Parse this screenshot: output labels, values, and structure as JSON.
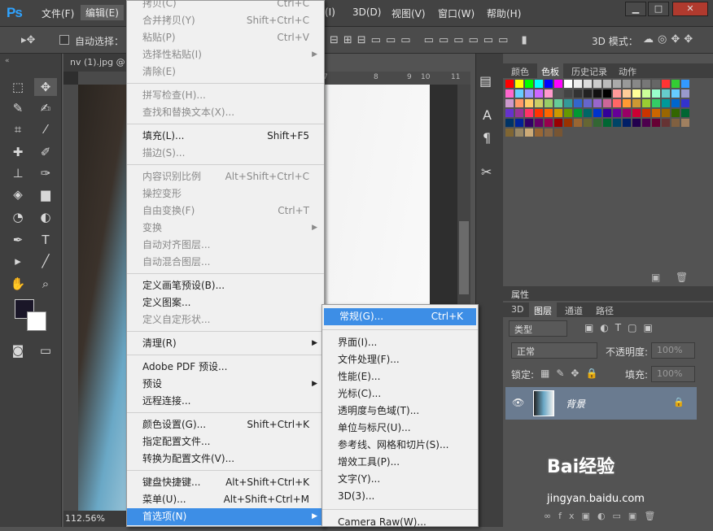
{
  "app": {
    "logo": "Ps"
  },
  "menubar": {
    "items": [
      "文件(F)",
      "编辑(E)",
      "(I)",
      "3D(D)",
      "视图(V)",
      "窗口(W)",
      "帮助(H)"
    ]
  },
  "window_buttons": {
    "minimize": "▁",
    "restore": "□",
    "close": "✕"
  },
  "options_bar": {
    "auto_select_label": "自动选择：",
    "mode_3d_label": "3D 模式："
  },
  "document": {
    "tab_title": "nv (1).jpg @",
    "zoom": "112.56%"
  },
  "ruler": {
    "ticks": [
      "7",
      "8",
      "9",
      "10",
      "11"
    ]
  },
  "panels": {
    "swatch_tabs": [
      "颜色",
      "色板",
      "历史记录",
      "动作"
    ],
    "swatch_tab_selected": "色板",
    "properties_title": "属性",
    "layer_tabs": [
      "3D",
      "图层",
      "通道",
      "路径"
    ],
    "layer_tab_selected": "图层",
    "filter_kind": "类型",
    "blend_mode": "正常",
    "opacity_label": "不透明度:",
    "opacity_value": "100%",
    "lock_label": "锁定:",
    "fill_label": "填充:",
    "fill_value": "100%",
    "layer_name": "背景"
  },
  "edit_menu": [
    {
      "label": "拷贝(C)",
      "shortcut": "Ctrl+C",
      "disabled": true,
      "partial": true
    },
    {
      "label": "合并拷贝(Y)",
      "shortcut": "Shift+Ctrl+C",
      "disabled": true
    },
    {
      "label": "粘贴(P)",
      "shortcut": "Ctrl+V",
      "disabled": true
    },
    {
      "label": "选择性粘贴(I)",
      "shortcut": "",
      "disabled": true,
      "submenu": true
    },
    {
      "label": "清除(E)",
      "shortcut": "",
      "disabled": true
    },
    {
      "sep": true
    },
    {
      "label": "拼写检查(H)...",
      "shortcut": "",
      "disabled": true
    },
    {
      "label": "查找和替换文本(X)...",
      "shortcut": "",
      "disabled": true
    },
    {
      "sep": true
    },
    {
      "label": "填充(L)...",
      "shortcut": "Shift+F5",
      "disabled": false
    },
    {
      "label": "描边(S)...",
      "shortcut": "",
      "disabled": true
    },
    {
      "sep": true
    },
    {
      "label": "内容识别比例",
      "shortcut": "Alt+Shift+Ctrl+C",
      "disabled": true
    },
    {
      "label": "操控变形",
      "shortcut": "",
      "disabled": true
    },
    {
      "label": "自由变换(F)",
      "shortcut": "Ctrl+T",
      "disabled": true
    },
    {
      "label": "变换",
      "shortcut": "",
      "disabled": true,
      "submenu": true
    },
    {
      "label": "自动对齐图层...",
      "shortcut": "",
      "disabled": true
    },
    {
      "label": "自动混合图层...",
      "shortcut": "",
      "disabled": true
    },
    {
      "sep": true
    },
    {
      "label": "定义画笔预设(B)...",
      "shortcut": "",
      "disabled": false
    },
    {
      "label": "定义图案...",
      "shortcut": "",
      "disabled": false
    },
    {
      "label": "定义自定形状...",
      "shortcut": "",
      "disabled": true
    },
    {
      "sep": true
    },
    {
      "label": "清理(R)",
      "shortcut": "",
      "disabled": false,
      "submenu": true
    },
    {
      "sep": true
    },
    {
      "label": "Adobe PDF 预设...",
      "shortcut": "",
      "disabled": false
    },
    {
      "label": "预设",
      "shortcut": "",
      "disabled": false,
      "submenu": true
    },
    {
      "label": "远程连接...",
      "shortcut": "",
      "disabled": false
    },
    {
      "sep": true
    },
    {
      "label": "颜色设置(G)...",
      "shortcut": "Shift+Ctrl+K",
      "disabled": false
    },
    {
      "label": "指定配置文件...",
      "shortcut": "",
      "disabled": false
    },
    {
      "label": "转换为配置文件(V)...",
      "shortcut": "",
      "disabled": false
    },
    {
      "sep": true
    },
    {
      "label": "键盘快捷键...",
      "shortcut": "Alt+Shift+Ctrl+K",
      "disabled": false
    },
    {
      "label": "菜单(U)...",
      "shortcut": "Alt+Shift+Ctrl+M",
      "disabled": false
    },
    {
      "label": "首选项(N)",
      "shortcut": "",
      "disabled": false,
      "submenu": true,
      "highlight": true
    }
  ],
  "prefs_submenu": [
    {
      "label": "常规(G)...",
      "shortcut": "Ctrl+K",
      "highlight": true
    },
    {
      "sep": true
    },
    {
      "label": "界面(I)..."
    },
    {
      "label": "文件处理(F)..."
    },
    {
      "label": "性能(E)..."
    },
    {
      "label": "光标(C)..."
    },
    {
      "label": "透明度与色域(T)..."
    },
    {
      "label": "单位与标尺(U)..."
    },
    {
      "label": "参考线、网格和切片(S)..."
    },
    {
      "label": "增效工具(P)..."
    },
    {
      "label": "文字(Y)..."
    },
    {
      "label": "3D(3)..."
    },
    {
      "sep": true
    },
    {
      "label": "Camera Raw(W)..."
    }
  ],
  "watermark": {
    "brand": "Bai经验",
    "url": "jingyan.baidu.com"
  },
  "colors": {
    "highlight": "#3d8ee6",
    "menu_bg": "#f0f0f0",
    "panel_bg": "#535353",
    "swatches": [
      "#ff0000",
      "#ffff00",
      "#00ff00",
      "#00ffff",
      "#0000ff",
      "#ff00ff",
      "#ffffff",
      "#eeeeee",
      "#dddddd",
      "#cccccc",
      "#bbbbbb",
      "#aaaaaa",
      "#999999",
      "#888888",
      "#777777",
      "#666666",
      "#ff3333",
      "#33cc33",
      "#3399ff",
      "#ff66cc",
      "#66ccff",
      "#9999ff",
      "#cc66ff",
      "#ff99cc",
      "#555555",
      "#444444",
      "#333333",
      "#222222",
      "#111111",
      "#000000",
      "#ff9999",
      "#ffcc99",
      "#ffff99",
      "#ccff99",
      "#99ffcc",
      "#66cccc",
      "#66ccff",
      "#9999cc",
      "#cc99cc",
      "#ff9966",
      "#ffcc66",
      "#cccc66",
      "#99cc66",
      "#66cc99",
      "#339999",
      "#3366cc",
      "#6666cc",
      "#9966cc",
      "#cc6699",
      "#ff6666",
      "#ff9933",
      "#cc9933",
      "#99cc33",
      "#33cc66",
      "#009999",
      "#0066cc",
      "#3333cc",
      "#6633cc",
      "#993399",
      "#ff3366",
      "#ff3300",
      "#ff6600",
      "#cc9900",
      "#669900",
      "#009933",
      "#006666",
      "#0033cc",
      "#330099",
      "#660099",
      "#990066",
      "#cc0033",
      "#cc3300",
      "#cc6600",
      "#996600",
      "#336600",
      "#006633",
      "#003366",
      "#002299",
      "#330066",
      "#660066",
      "#99004d",
      "#990000",
      "#993300",
      "#996633",
      "#666633",
      "#336633",
      "#006633",
      "#004466",
      "#001f66",
      "#22004d",
      "#4d004d",
      "#660033",
      "#663333",
      "#806040",
      "#a08060",
      "#806633",
      "#998866",
      "#ccaa77",
      "#996633",
      "#886644",
      "#775533"
    ]
  }
}
